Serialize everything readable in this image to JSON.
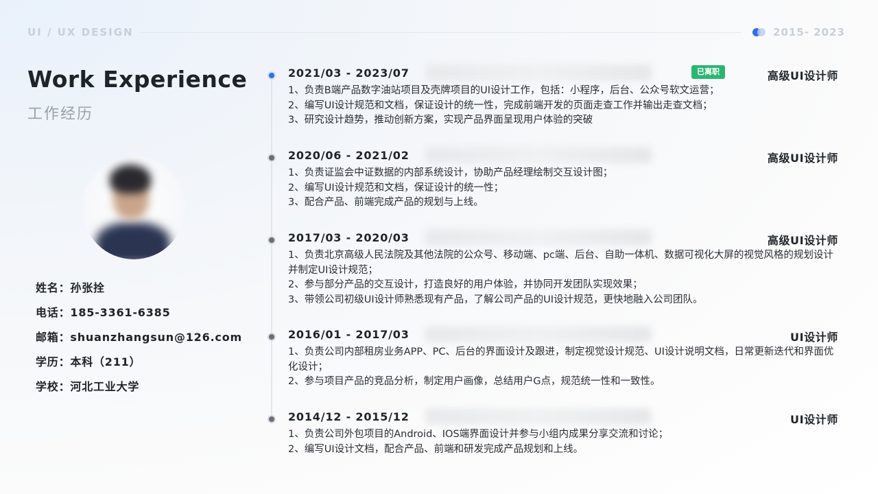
{
  "header": {
    "label": "UI / UX DESIGN",
    "range": "2015- 2023"
  },
  "title": {
    "en": "Work Experience",
    "cn": "工作经历"
  },
  "profile": {
    "rows": [
      "姓名：孙张拴",
      "电话：185-3361-6385",
      "邮箱：shuanzhangsun@126.com",
      "学历：本科（211）",
      "学校：河北工业大学"
    ]
  },
  "colors": {
    "accent": "#2f6fe8",
    "badge": "#2bb673"
  },
  "experience": [
    {
      "period": "2021/03 - 2023/07",
      "badge": "已离职",
      "role": "高级UI设计师",
      "duties": [
        "1、负责B端产品数字油站项目及壳牌项目的UI设计工作，包括：小程序，后台、公众号软文运营；",
        "2、编写UI设计规范和文档，保证设计的统一性，完成前端开发的页面走查工作并输出走查文档；",
        "3、研究设计趋势，推动创新方案，实现产品界面呈现用户体验的突破"
      ]
    },
    {
      "period": "2020/06 - 2021/02",
      "badge": "",
      "role": "高级UI设计师",
      "duties": [
        "1、负责证监会中证数据的内部系统设计，协助产品经理绘制交互设计图；",
        "2、编写UI设计规范和文档，保证设计的统一性；",
        "3、配合产品、前端完成产品的规划与上线。"
      ]
    },
    {
      "period": "2017/03 - 2020/03",
      "badge": "",
      "role": "高级UI设计师",
      "duties": [
        "1、负责北京高级人民法院及其他法院的公众号、移动端、pc端、后台、自助一体机、数据可视化大屏的视觉风格的规划设计并制定UI设计规范；",
        "2、参与部分产品的交互设计，打造良好的用户体验，并协同开发团队实现效果；",
        "3、带领公司初级UI设计师熟悉现有产品，了解公司产品的UI设计规范，更快地融入公司团队。"
      ]
    },
    {
      "period": "2016/01 - 2017/03",
      "badge": "",
      "role": "UI设计师",
      "duties": [
        "1、负责公司内部租房业务APP、PC、后台的界面设计及跟进，制定视觉设计规范、UI设计说明文档，日常更新迭代和界面优化设计；",
        "2、参与项目产品的竞品分析，制定用户画像，总结用户G点，规范统一性和一致性。"
      ]
    },
    {
      "period": "2014/12 - 2015/12",
      "badge": "",
      "role": "UI设计师",
      "duties": [
        "1、负责公司外包项目的Android、IOS端界面设计并参与小组内成果分享交流和讨论；",
        "2、编写UI设计文档，配合产品、前端和研发完成产品规划和上线。"
      ]
    }
  ]
}
